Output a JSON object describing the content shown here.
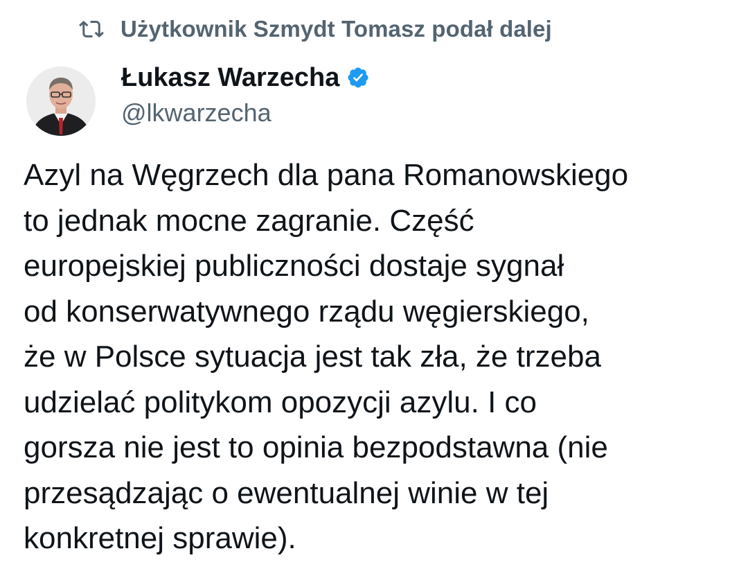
{
  "retweet": {
    "icon": "retweet-icon",
    "text": "Użytkownik Szmydt Tomasz podał dalej"
  },
  "author": {
    "avatar": "avatar-photo",
    "display_name": "Łukasz Warzecha",
    "verified_icon": "verified-badge-icon",
    "handle": "@lkwarzecha"
  },
  "tweet": {
    "lines": [
      "Azyl na Węgrzech dla pana Romanowskiego",
      "to jednak mocne zagranie. Część",
      "europejskiej publiczności dostaje sygnał",
      "od konserwatywnego rządu węgierskiego,",
      "że w Polsce sytuacja jest tak zła, że trzeba",
      "udzielać politykom opozycji azylu. I co",
      "gorsza nie jest to opinia bezpodstawna (nie",
      "przesądzając o ewentualnej winie w tej",
      "konkretnej sprawie)."
    ]
  },
  "colors": {
    "text_primary": "#0f1419",
    "text_secondary": "#536471",
    "verified": "#1d9bf0"
  }
}
